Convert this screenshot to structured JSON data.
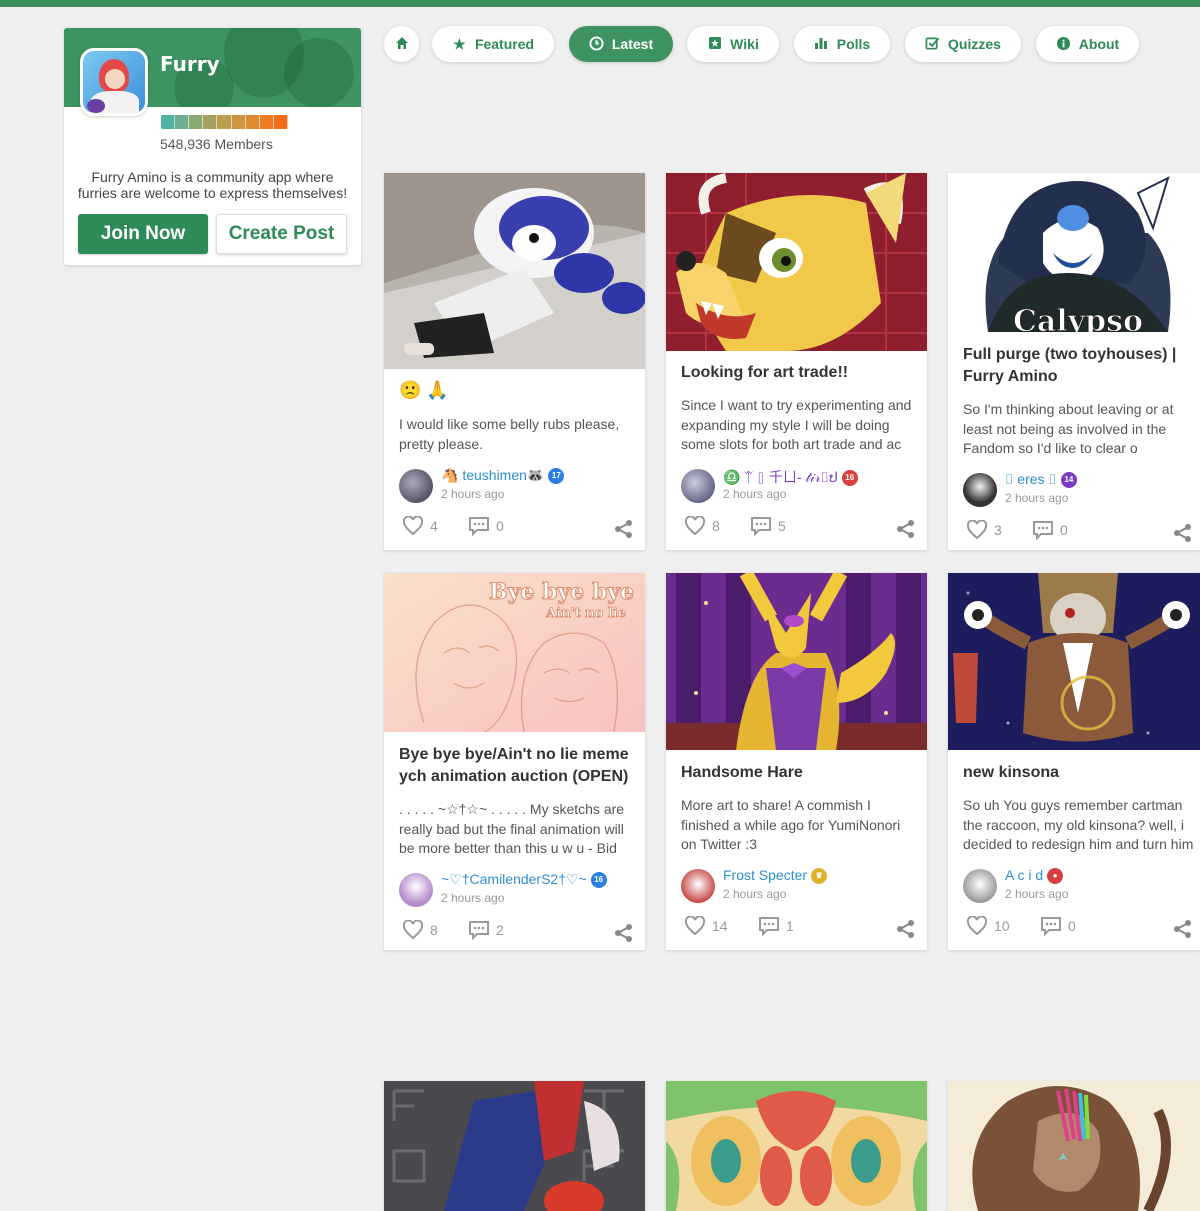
{
  "community": {
    "name": "Furry",
    "members": "548,936 Members",
    "description": "Furry Amino is a community app where furries are welcome to express themselves!",
    "join_label": "Join Now",
    "create_label": "Create Post",
    "level_colors": [
      "#4fb3a3",
      "#6fae8e",
      "#8aa872",
      "#a3a35f",
      "#b99c4d",
      "#cf9440",
      "#e08a33",
      "#ee7b22",
      "#f26c1a"
    ]
  },
  "nav": {
    "home_icon": "home-icon",
    "tabs": [
      {
        "label": "Featured",
        "icon": "star-icon"
      },
      {
        "label": "Latest",
        "icon": "clock-icon",
        "active": true
      },
      {
        "label": "Wiki",
        "icon": "book-icon"
      },
      {
        "label": "Polls",
        "icon": "bar-chart-icon"
      },
      {
        "label": "Quizzes",
        "icon": "checkbox-icon"
      },
      {
        "label": "About",
        "icon": "info-icon"
      }
    ]
  },
  "posts": [
    {
      "title": "",
      "emoji": "🙁 🙏",
      "body": "I would like some belly rubs please, pretty please.",
      "author": "🐴 teushimen🦝",
      "level": "17",
      "time": "2 hours ago",
      "likes": "4",
      "comments": "0"
    },
    {
      "title": "Looking for art trade!!",
      "body": "Since I want to try experimenting and expanding my style I will be doing some slots for both art trade and ac",
      "author": "♎ ᛠ ⌷ 千ㄩ- 𝓉𝒾𝓇⌷ປ",
      "level": "16",
      "time": "2 hours ago",
      "likes": "8",
      "comments": "5"
    },
    {
      "title": "Full purge (two toyhouses) | Furry Amino",
      "body": "So I'm thinking about leaving or at least not being as involved in the Fandom so I'd like to clear o",
      "author": "⌷ eres ⌷",
      "level": "14",
      "time": "2 hours ago",
      "likes": "3",
      "comments": "0"
    },
    {
      "title": "Bye bye bye/Ain't no lie meme ych animation auction (OPEN)",
      "body": ". . . . . ~☆†☆~ . . . . . My sketchs are really bad but the final animation will be more better than this u w u - Bid",
      "author": "~♡†CamilenderS2†♡~",
      "level": "16",
      "time": "2 hours ago",
      "likes": "8",
      "comments": "2"
    },
    {
      "title": "Handsome Hare",
      "body": "More art to share! A commish I finished a while ago for YumiNonori on Twitter :3",
      "author": "Frost Specter",
      "level": "",
      "time": "2 hours ago",
      "likes": "14",
      "comments": "1"
    },
    {
      "title": "new kinsona",
      "body": "So uh You guys remember cartman the raccoon, my old kinsona? well, i decided to redesign him and turn him",
      "author": "A c i d",
      "level": "",
      "time": "2 hours ago",
      "likes": "10",
      "comments": "0"
    }
  ],
  "thumb_text": {
    "calypso": "Calypso",
    "bye": "Bye bye bye",
    "aint": "Ain't no lie"
  },
  "colors": {
    "accent": "#2e8b57",
    "accent_active": "#3d9462",
    "link": "#2e8fd0"
  }
}
